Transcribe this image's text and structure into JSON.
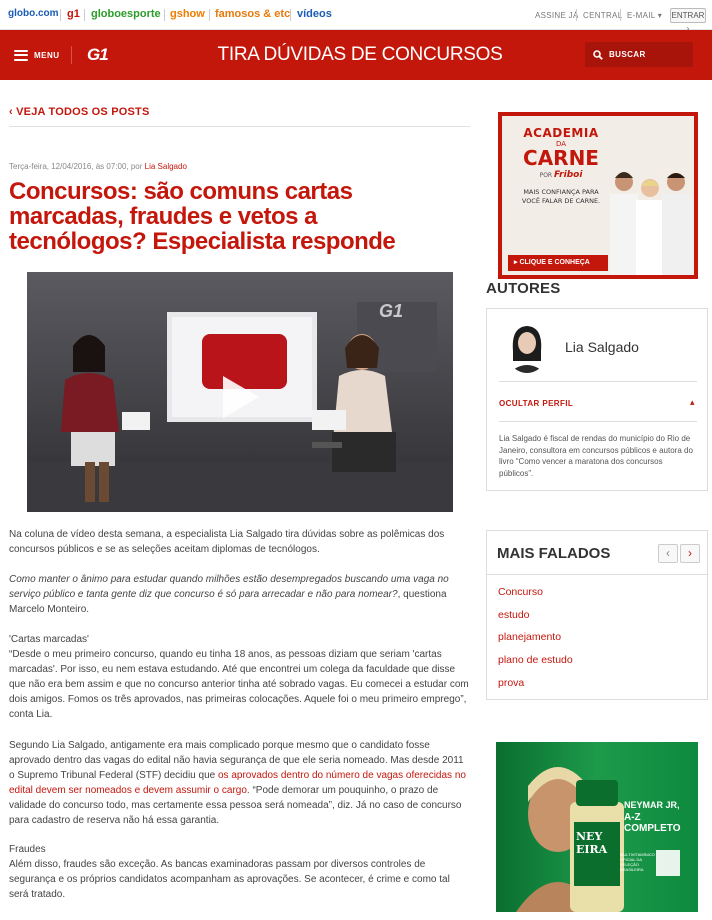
{
  "topbar": {
    "sites": [
      {
        "label": "globo.com",
        "color": "#1a5cb5"
      },
      {
        "label": "g1",
        "color": "#c4170c"
      },
      {
        "label": "globoesporte",
        "color": "#2a9d2a"
      },
      {
        "label": "gshow",
        "color": "#f07c00"
      },
      {
        "label": "famosos & etc",
        "color": "#e8790a"
      },
      {
        "label": "vídeos",
        "color": "#1a5cb5"
      }
    ],
    "assine": "ASSINE JÁ",
    "central": "CENTRAL",
    "email": "E-MAIL",
    "entrar": "ENTRAR"
  },
  "header": {
    "menu_label": "MENU",
    "logo": "G1",
    "blog_title": "TIRA DÚVIDAS DE CONCURSOS",
    "search_label": "BUSCAR",
    "color": "#c4170c"
  },
  "article": {
    "back_link": "VEJA TODOS OS POSTS",
    "meta_date": "Terça-feira, 12/04/2016, às 07:00, por ",
    "meta_author": "Lia Salgado",
    "title": "Concursos: são comuns cartas marcadas, fraudes e vetos a tecnólogos? Especialista responde",
    "video_logo": "G1",
    "p1": "Na coluna de vídeo desta semana, a especialista Lia Salgado tira dúvidas sobre as polêmicas dos concursos públicos e se as seleções aceitam diplomas de tecnólogos.",
    "q1_italic": "Como manter o ânimo para estudar quando milhões estão desempregados buscando uma vaga no serviço público e tanta gente diz que concurso é só para arrecadar e não para nomear?",
    "q1_tail": ", questiona Marcelo Monteiro.",
    "h_cartas": "'Cartas marcadas'",
    "p_cartas": "“Desde o meu primeiro concurso, quando eu tinha 18 anos, as pessoas diziam que seriam 'cartas marcadas'. Por isso, eu nem estava estudando. Até que encontrei um colega da faculdade que disse que não era bem assim e que no concurso anterior tinha até sobrado vagas. Eu comecei a estudar com dois amigos. Fomos os três aprovados, nas primeiras colocações. Aquele foi o meu primeiro emprego”, conta Lia.",
    "p_segundo_a": "Segundo Lia Salgado, antigamente era mais complicado porque mesmo que o candidato fosse aprovado dentro das vagas do edital não havia segurança de que ele seria nomeado. Mas desde 2011 o Supremo Tribunal Federal (STF) decidiu que ",
    "p_segundo_link": "os aprovados dentro do número de vagas oferecidas no edital devem ser nomeados e devem assumir o cargo",
    "p_segundo_b": ". “Pode demorar um pouquinho, o prazo de validade do concurso todo, mas certamente essa pessoa será nomeada”, diz. Já no caso de concurso para cadastro de reserva não há essa garantia.",
    "h_fraudes": "Fraudes",
    "p_fraudes": "Além disso, fraudes são exceção. As bancas examinadoras passam por diversos controles de segurança e os próprios candidatos acompanham as aprovações. Se acontecer, é crime e como tal será tratado."
  },
  "sidebar": {
    "ad1": {
      "line1": "ACADEMIA",
      "line2": "DA",
      "line3": "CARNE",
      "por": "POR",
      "brand": "Friboi",
      "tagline": "MAIS CONFIANÇA PARA VOCÊ FALAR DE CARNE.",
      "cta": "CLIQUE E CONHEÇA"
    },
    "autores_title": "AUTORES",
    "author_name": "Lia Salgado",
    "ocultar": "OCULTAR PERFIL",
    "bio": "Lia Salgado é fiscal de rendas do município do Rio de Janeiro, consultora em concursos públicos e autora do livro “Como vencer a maratona dos concursos públicos”.",
    "mais_falados_title": "MAIS FALADOS",
    "mais_falados": [
      "Concurso",
      "estudo",
      "planejamento",
      "plano de estudo",
      "prova"
    ],
    "ad2": {
      "bottle1": "NEY",
      "bottle2": "EIRA",
      "headline1": "NEYMAR JR,",
      "headline2": "A-Z COMPLETO",
      "badge": "MULTIVITAMÍNICO OFICIAL DA SELEÇÃO BRASILEIRA"
    }
  }
}
